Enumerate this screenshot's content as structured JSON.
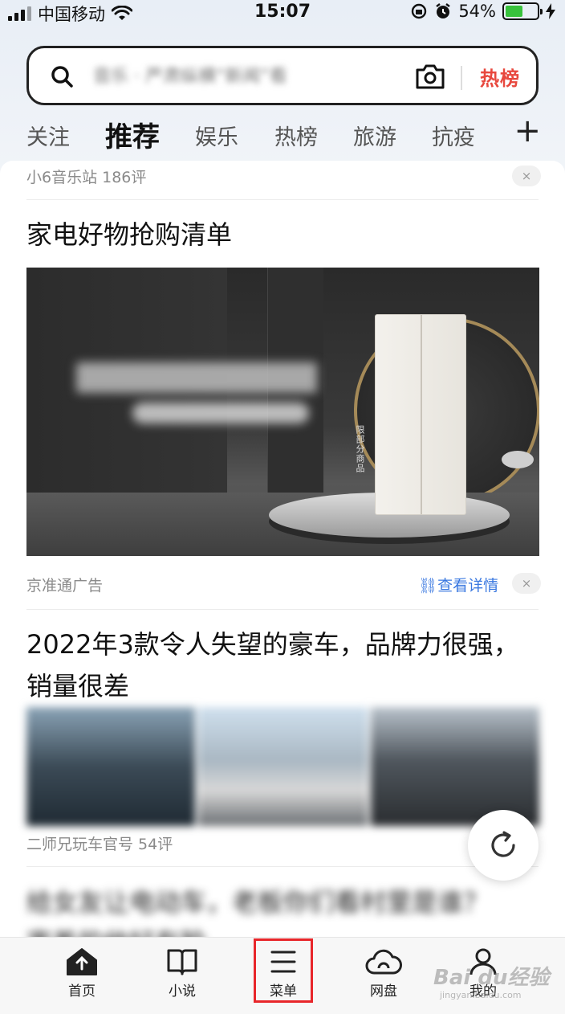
{
  "status_bar": {
    "carrier": "中国移动",
    "time": "15:07",
    "battery": "54%",
    "battery_level": 0.54
  },
  "search": {
    "placeholder": "音乐 · 严肃纵横“新闻”看",
    "hot_label": "热榜",
    "icons": [
      "search-icon",
      "camera-icon"
    ]
  },
  "tabs": {
    "items": [
      "关注",
      "推荐",
      "娱乐",
      "热榜",
      "旅游",
      "抗疫"
    ],
    "active": "推荐",
    "add_label": "+"
  },
  "feed": {
    "item1_meta": "小6音乐站  186评",
    "ad": {
      "title": "家电好物抢购清单",
      "image_tag": "限部分商品",
      "source": "京准通广告",
      "detail_link": "查看详情"
    },
    "article": {
      "title": "2022年3款令人失望的豪车，品牌力很强，销量很差",
      "meta": "二师兄玩车官号  54评"
    },
    "next_title_blurred": "给女友让电动车，老板你们看村里是谁？ 害羞的他好有脸",
    "close_label": "×"
  },
  "bottom_nav": {
    "items": [
      {
        "label": "首页",
        "icon": "home-upload-icon"
      },
      {
        "label": "小说",
        "icon": "book-icon"
      },
      {
        "label": "菜单",
        "icon": "menu-icon"
      },
      {
        "label": "网盘",
        "icon": "cloud-icon"
      },
      {
        "label": "我的",
        "icon": "profile-icon"
      }
    ]
  },
  "watermark": {
    "brand": "Bai du经验",
    "url": "jingyan.baidu.com"
  },
  "colors": {
    "accent_red": "#e8483e",
    "link_blue": "#3a78e0",
    "highlight_red": "#e8262a"
  }
}
